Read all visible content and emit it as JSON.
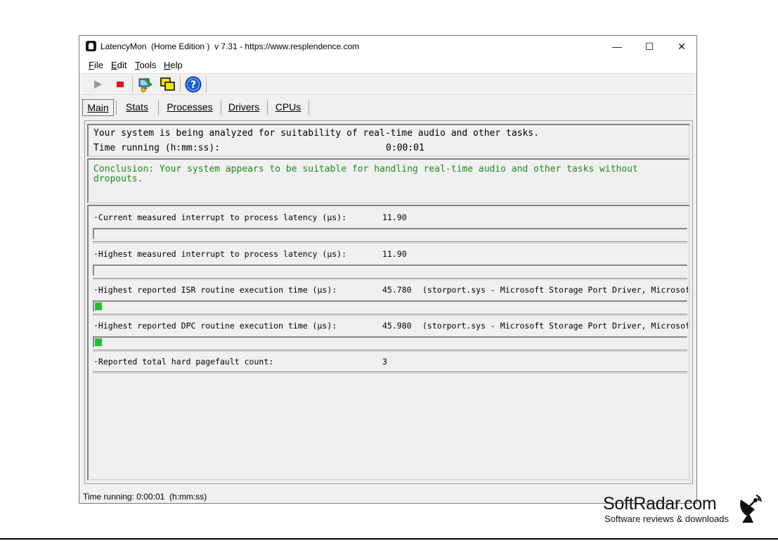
{
  "window": {
    "title": "LatencyMon  (Home Edition )  v 7.31 - https://www.resplendence.com",
    "minimize_glyph": "—",
    "maximize_glyph": "☐",
    "close_glyph": "✕"
  },
  "menu": [
    "File",
    "Edit",
    "Tools",
    "Help"
  ],
  "toolbar": {
    "buttons": [
      "play-icon",
      "stop-icon",
      "monitor-icon",
      "windows-icon",
      "help-icon"
    ],
    "colors": {
      "stop": "#e01010",
      "help": "#1c5fd1",
      "meter_fill": "#22c02a",
      "conclusion": "#1f8a1f"
    }
  },
  "tabs": [
    "Main",
    "Stats",
    "Processes",
    "Drivers",
    "CPUs"
  ],
  "analysis": {
    "line1": "Your system is being analyzed for suitability of real-time audio and other tasks.",
    "time_label": "Time running (h:mm:ss):",
    "time_value": "0:00:01"
  },
  "conclusion": {
    "text": "Conclusion: Your system appears to be suitable for handling real-time audio and other tasks without dropouts."
  },
  "metrics": [
    {
      "label": "·Current measured interrupt to process latency (µs):",
      "value": "11.90",
      "detail": "",
      "bar_fraction": 0
    },
    {
      "label": "·Highest measured interrupt to process latency (µs):",
      "value": "11.90",
      "detail": "",
      "bar_fraction": 0
    },
    {
      "label": "·Highest reported ISR routine execution time (µs):",
      "value": "45.780",
      "detail": "(storport.sys - Microsoft Storage Port Driver, Microsoft Corporation)",
      "bar_fraction": 0.012
    },
    {
      "label": "·Highest reported DPC routine execution time (µs):",
      "value": "45.980",
      "detail": "(storport.sys - Microsoft Storage Port Driver, Microsoft Corporation)",
      "bar_fraction": 0.012
    },
    {
      "label": "·Reported total hard pagefault count:",
      "value": "3",
      "detail": "",
      "bar_fraction": 0
    }
  ],
  "status": {
    "text": "Time running: 0:00:01  (h:mm:ss)"
  },
  "watermark": {
    "brand": "SoftRadar.com",
    "tagline": "Software reviews & downloads"
  }
}
